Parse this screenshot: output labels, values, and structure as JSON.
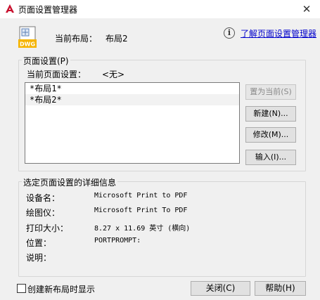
{
  "window": {
    "title": "页面设置管理器",
    "close_glyph": "✕"
  },
  "header": {
    "current_layout_label": "当前布局：",
    "current_layout_value": "布局2",
    "dwg_label": "DWG",
    "help_link": "了解页面设置管理器"
  },
  "page_setups": {
    "group_title": "页面设置(P)",
    "current_label": "当前页面设置：",
    "current_value": "<无>",
    "items": [
      {
        "label": "*布局1*"
      },
      {
        "label": "*布局2*"
      }
    ],
    "buttons": {
      "set_current": "置为当前(S)",
      "new": "新建(N)...",
      "modify": "修改(M)...",
      "import": "输入(I)..."
    }
  },
  "details": {
    "group_title": "选定页面设置的详细信息",
    "rows": [
      {
        "label": "设备名：",
        "value": "Microsoft Print to PDF"
      },
      {
        "label": "绘图仪：",
        "value": "Microsoft Print To PDF"
      },
      {
        "label": "打印大小：",
        "value": "8.27 x 11.69 英寸 (横向)"
      },
      {
        "label": "位置：",
        "value": "PORTPROMPT:"
      },
      {
        "label": "说明：",
        "value": ""
      }
    ]
  },
  "footer": {
    "show_on_new_layout": "创建新布局时显示",
    "show_on_new_layout_checked": false,
    "close_button": "关闭(C)",
    "help_button": "帮助(H)"
  },
  "colors": {
    "link": "#0000cc",
    "app_icon_red": "#c8102e",
    "dwg_yellow": "#f5b400"
  }
}
